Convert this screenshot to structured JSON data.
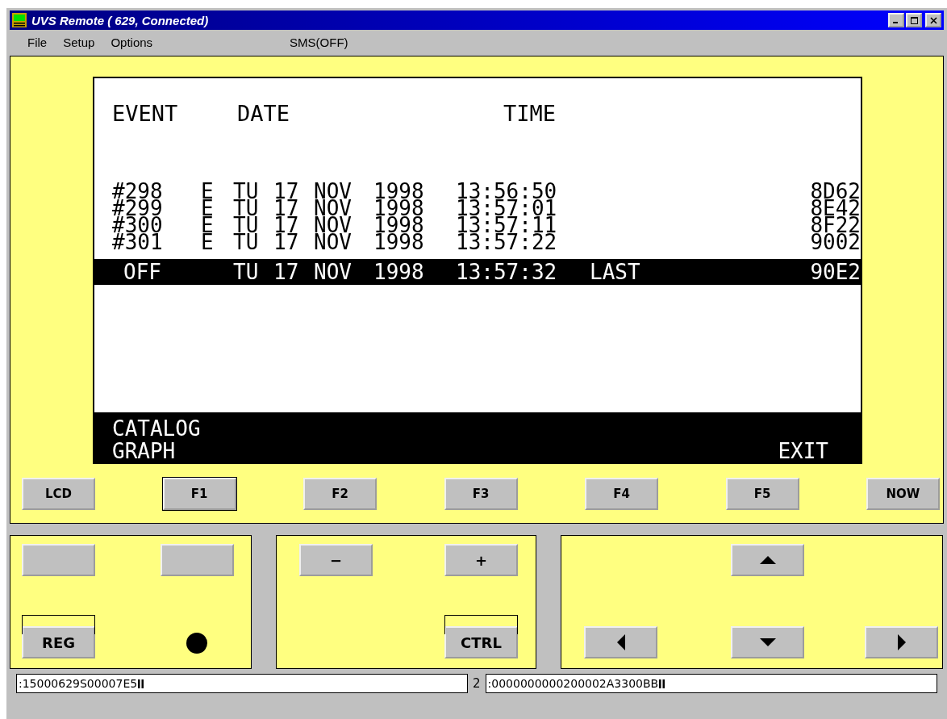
{
  "window": {
    "title": "UVS Remote ( 629, Connected)"
  },
  "menu": [
    "File",
    "Setup",
    "Options"
  ],
  "sms_status": "SMS(OFF)",
  "lcd": {
    "headers": [
      "EVENT",
      "DATE",
      "TIME"
    ],
    "rows": [
      {
        "event": "#298",
        "flag": "E",
        "day": "TU",
        "date": "17",
        "month": "NOV",
        "year": "1998",
        "time": "13:56:50",
        "code": "8D62",
        "selected": false
      },
      {
        "event": "#299",
        "flag": "E",
        "day": "TU",
        "date": "17",
        "month": "NOV",
        "year": "1998",
        "time": "13:57:01",
        "code": "8E42",
        "selected": false
      },
      {
        "event": "#300",
        "flag": "E",
        "day": "TU",
        "date": "17",
        "month": "NOV",
        "year": "1998",
        "time": "13:57:11",
        "code": "8F22",
        "selected": false
      },
      {
        "event": "#301",
        "flag": "E",
        "day": "TU",
        "date": "17",
        "month": "NOV",
        "year": "1998",
        "time": "13:57:22",
        "code": "9002",
        "selected": false
      },
      {
        "event": "OFF",
        "day": "TU",
        "date": "17",
        "month": "NOV",
        "year": "1998",
        "time": "13:57:32",
        "note": "LAST",
        "code": "90E2",
        "selected": true
      }
    ],
    "softkeys_left": [
      "CATALOG",
      "GRAPH"
    ],
    "softkey_right": "EXIT"
  },
  "function_keys": [
    {
      "label": "LCD",
      "focused": false
    },
    {
      "label": "F1",
      "focused": true
    },
    {
      "label": "F2",
      "focused": false
    },
    {
      "label": "F3",
      "focused": false
    },
    {
      "label": "F4",
      "focused": false
    },
    {
      "label": "F5",
      "focused": false
    },
    {
      "label": "NOW",
      "focused": false
    }
  ],
  "panels": [
    {
      "keys": [
        {
          "kind": "blank"
        },
        {
          "kind": "blank"
        },
        {
          "kind": "label",
          "label": "REG",
          "framed": true
        },
        {
          "kind": "led"
        }
      ]
    },
    {
      "keys": [
        {
          "kind": "label",
          "label": "−"
        },
        {
          "kind": "label",
          "label": "+"
        },
        {
          "kind": "empty"
        },
        {
          "kind": "label",
          "label": "CTRL",
          "framed": true
        }
      ]
    },
    {
      "keys": [
        {
          "kind": "empty"
        },
        {
          "kind": "up"
        },
        {
          "kind": "empty"
        },
        {
          "kind": "left"
        },
        {
          "kind": "down"
        },
        {
          "kind": "right"
        }
      ]
    }
  ],
  "status_bar": {
    "field_1": ":15000629S00007E5",
    "separator": "2",
    "field_2": ":0000000000200002A3300BB"
  }
}
